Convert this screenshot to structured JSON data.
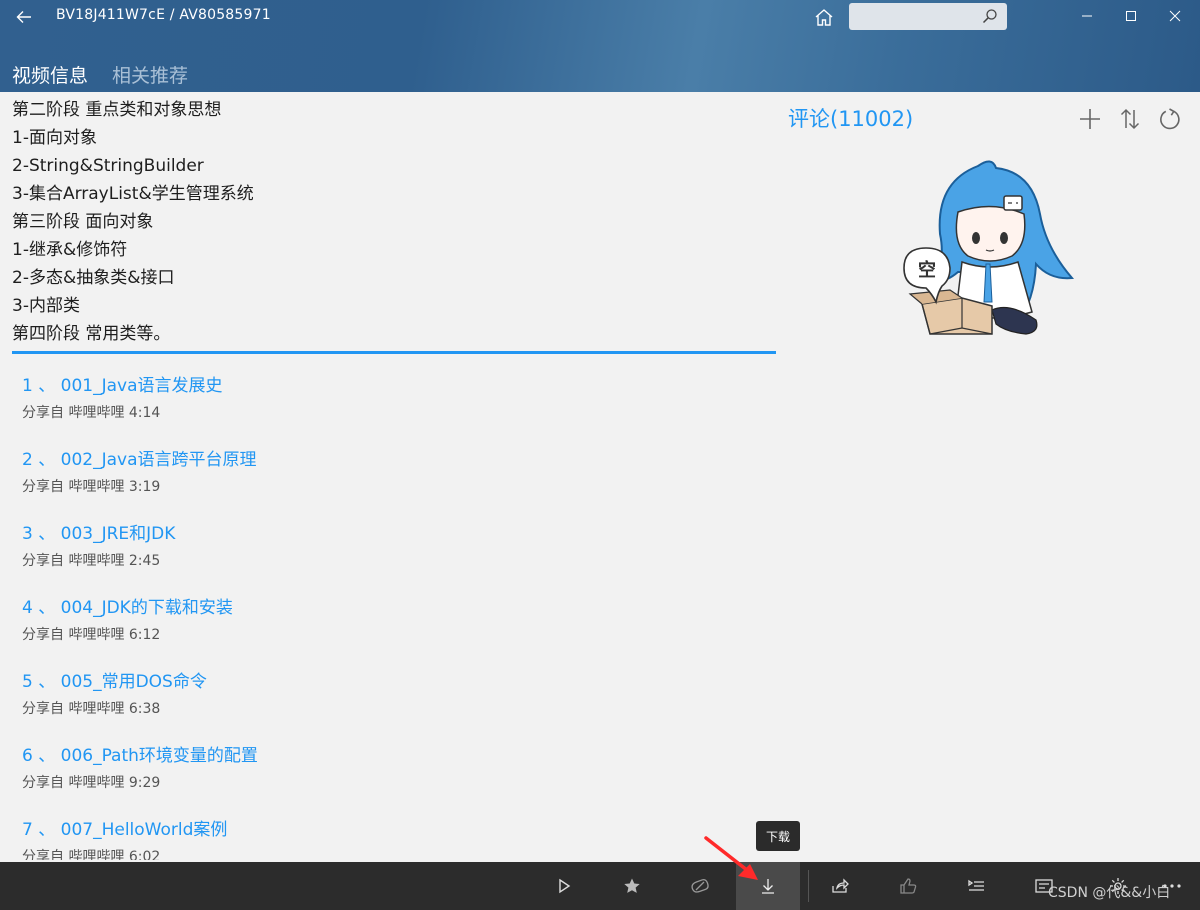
{
  "window": {
    "title": "BV18J411W7cE / AV80585971",
    "search_placeholder": ""
  },
  "tabs": [
    {
      "label": "视频信息",
      "active": true
    },
    {
      "label": "相关推荐",
      "active": false
    }
  ],
  "description": [
    "第二阶段  重点类和对象思想",
    "1-面向对象",
    "2-String&StringBuilder",
    "3-集合ArrayList&学生管理系统",
    "第三阶段 面向对象",
    "1-继承&修饰符",
    "2-多态&抽象类&接口",
    "3-内部类",
    "第四阶段 常用类等。"
  ],
  "videos": [
    {
      "title": "1 、 001_Java语言发展史",
      "meta": "分享自 哔哩哔哩 4:14"
    },
    {
      "title": "2 、 002_Java语言跨平台原理",
      "meta": "分享自 哔哩哔哩 3:19"
    },
    {
      "title": "3 、 003_JRE和JDK",
      "meta": "分享自 哔哩哔哩 2:45"
    },
    {
      "title": "4 、 004_JDK的下载和安装",
      "meta": "分享自 哔哩哔哩 6:12"
    },
    {
      "title": "5 、 005_常用DOS命令",
      "meta": "分享自 哔哩哔哩 6:38"
    },
    {
      "title": "6 、 006_Path环境变量的配置",
      "meta": "分享自 哔哩哔哩 9:29"
    },
    {
      "title": "7 、 007_HelloWorld案例",
      "meta": "分享自 哔哩哔哩 6:02"
    }
  ],
  "comments": {
    "title": "评论(11002)",
    "empty_badge": "空"
  },
  "tooltip": {
    "text": "下载"
  },
  "watermark": "CSDN @代&&小白",
  "colors": {
    "accent": "#2196f3",
    "header": "#31608f",
    "bottombar": "#2c2c2c"
  },
  "bottom_icons": [
    "play-icon",
    "star-icon",
    "tag-icon",
    "download-icon",
    "share-icon",
    "like-icon",
    "playlist-icon",
    "danmaku-icon",
    "settings-icon",
    "more-icon"
  ]
}
